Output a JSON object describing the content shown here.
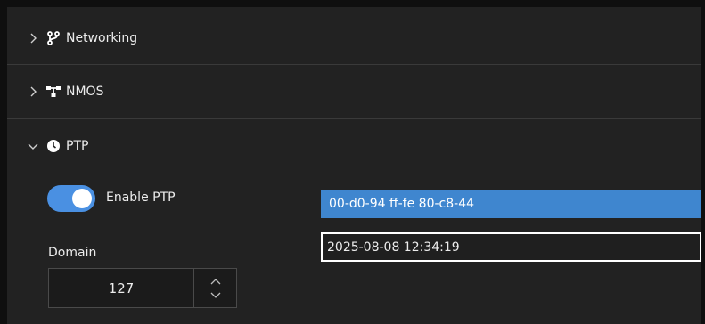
{
  "sections": [
    {
      "label": "Networking",
      "icon": "branch-icon",
      "expanded": false
    },
    {
      "label": "NMOS",
      "icon": "network-nodes-icon",
      "expanded": false
    },
    {
      "label": "PTP",
      "icon": "clock-icon",
      "expanded": true
    }
  ],
  "ptp": {
    "enable_label": "Enable PTP",
    "enabled": true,
    "domain_label": "Domain",
    "domain_value": "127",
    "clock_identity": "00-d0-94 ff-fe 80-c8-44",
    "datetime": "2025-08-08 12:34:19"
  },
  "colors": {
    "accent": "#4a90e2",
    "selection": "#3f86cf",
    "background": "#222222"
  }
}
